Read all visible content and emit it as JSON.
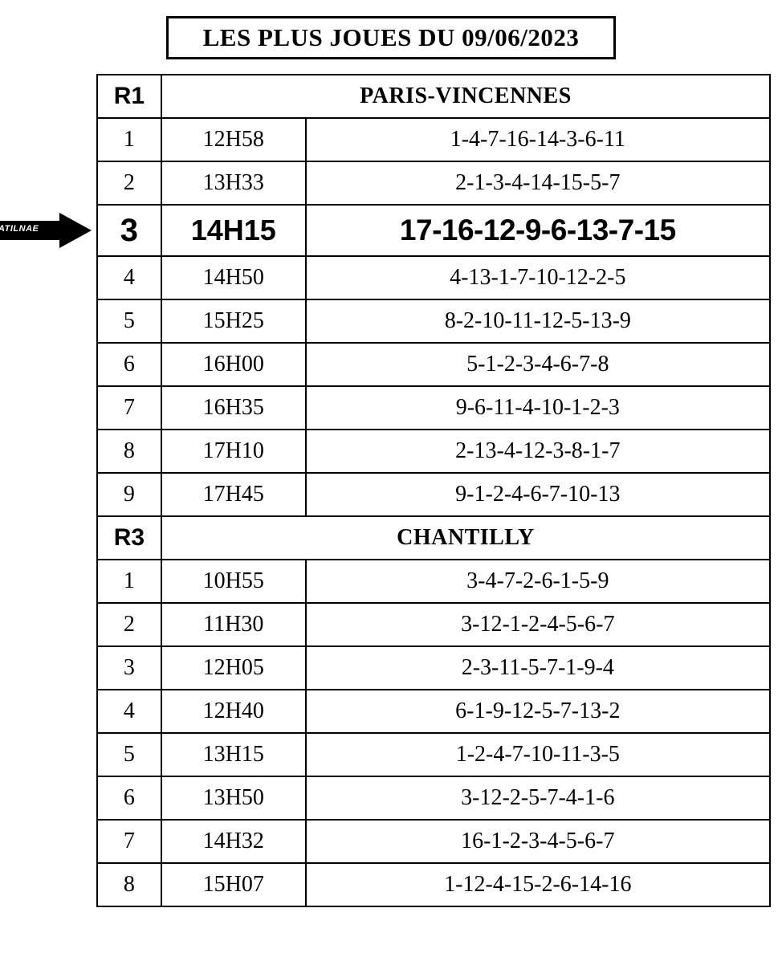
{
  "title": "LES PLUS JOUES DU 09/06/2023",
  "arrow_label": "ATILNAE",
  "meetings": [
    {
      "id": "R1",
      "name": "PARIS-VINCENNES",
      "featured_index": 2,
      "races": [
        {
          "n": "1",
          "time": "12H58",
          "nums": "1-4-7-16-14-3-6-11"
        },
        {
          "n": "2",
          "time": "13H33",
          "nums": "2-1-3-4-14-15-5-7"
        },
        {
          "n": "3",
          "time": "14H15",
          "nums": "17-16-12-9-6-13-7-15"
        },
        {
          "n": "4",
          "time": "14H50",
          "nums": "4-13-1-7-10-12-2-5"
        },
        {
          "n": "5",
          "time": "15H25",
          "nums": "8-2-10-11-12-5-13-9"
        },
        {
          "n": "6",
          "time": "16H00",
          "nums": "5-1-2-3-4-6-7-8"
        },
        {
          "n": "7",
          "time": "16H35",
          "nums": "9-6-11-4-10-1-2-3"
        },
        {
          "n": "8",
          "time": "17H10",
          "nums": "2-13-4-12-3-8-1-7"
        },
        {
          "n": "9",
          "time": "17H45",
          "nums": "9-1-2-4-6-7-10-13"
        }
      ]
    },
    {
      "id": "R3",
      "name": "CHANTILLY",
      "featured_index": -1,
      "races": [
        {
          "n": "1",
          "time": "10H55",
          "nums": "3-4-7-2-6-1-5-9"
        },
        {
          "n": "2",
          "time": "11H30",
          "nums": "3-12-1-2-4-5-6-7"
        },
        {
          "n": "3",
          "time": "12H05",
          "nums": "2-3-11-5-7-1-9-4"
        },
        {
          "n": "4",
          "time": "12H40",
          "nums": "6-1-9-12-5-7-13-2"
        },
        {
          "n": "5",
          "time": "13H15",
          "nums": "1-2-4-7-10-11-3-5"
        },
        {
          "n": "6",
          "time": "13H50",
          "nums": "3-12-2-5-7-4-1-6"
        },
        {
          "n": "7",
          "time": "14H32",
          "nums": "16-1-2-3-4-5-6-7"
        },
        {
          "n": "8",
          "time": "15H07",
          "nums": "1-12-4-15-2-6-14-16"
        }
      ]
    }
  ]
}
